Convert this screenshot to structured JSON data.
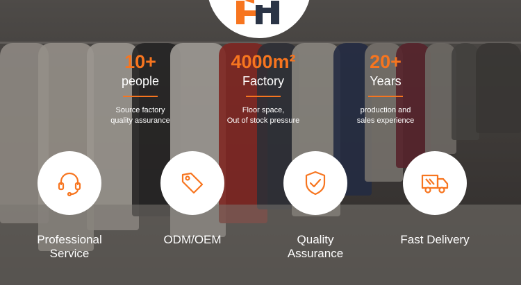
{
  "colors": {
    "accent": "#f7751f",
    "navy": "#2a3446",
    "white": "#ffffff"
  },
  "logo": {
    "icon": "brand-logo-icon"
  },
  "stats": [
    {
      "number": "10+",
      "unit": "people",
      "desc": "Source factory\nquality assurance"
    },
    {
      "number": "4000m²",
      "unit": "Factory",
      "desc": "Floor space,\nOut of stock pressure"
    },
    {
      "number": "20+",
      "unit": "Years",
      "desc": "production and\nsales experience"
    }
  ],
  "features": [
    {
      "label": "Professional\nService",
      "icon": "headset-icon"
    },
    {
      "label": "ODM/OEM",
      "icon": "price-tag-icon"
    },
    {
      "label": "Quality\nAssurance",
      "icon": "shield-check-icon"
    },
    {
      "label": "Fast Delivery",
      "icon": "delivery-truck-icon"
    }
  ]
}
